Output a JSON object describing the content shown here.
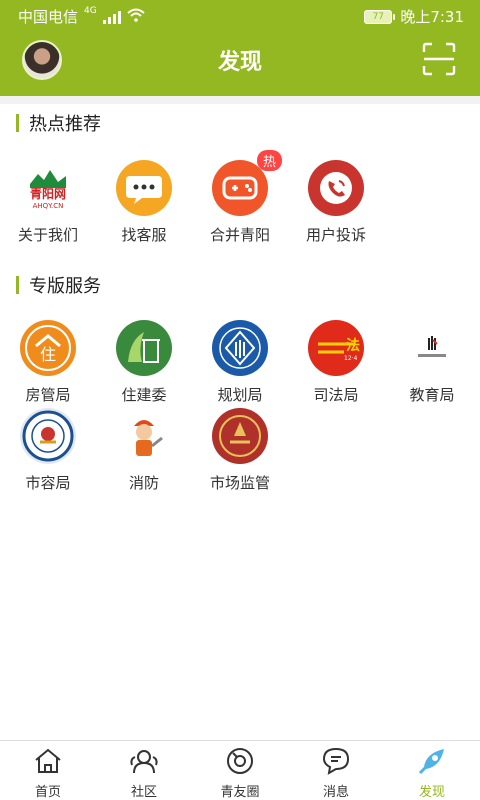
{
  "status": {
    "carrier": "中国电信",
    "network": "4G",
    "battery": "77",
    "time": "晚上7:31"
  },
  "header": {
    "title": "发现"
  },
  "sections": [
    {
      "title": "热点推荐",
      "items": [
        {
          "label": "关于我们",
          "icon": "qingyang-logo-icon"
        },
        {
          "label": "找客服",
          "icon": "chat-bubble-icon"
        },
        {
          "label": "合并青阳",
          "icon": "gamepad-icon",
          "badge": "热"
        },
        {
          "label": "用户投诉",
          "icon": "phone-icon"
        }
      ]
    },
    {
      "title": "专版服务",
      "items": [
        {
          "label": "房管局",
          "icon": "house-bureau-icon"
        },
        {
          "label": "住建委",
          "icon": "construction-committee-icon"
        },
        {
          "label": "规划局",
          "icon": "planning-bureau-icon"
        },
        {
          "label": "司法局",
          "icon": "justice-bureau-icon"
        },
        {
          "label": "教育局",
          "icon": "education-bureau-icon"
        },
        {
          "label": "市容局",
          "icon": "city-appearance-icon"
        },
        {
          "label": "消防",
          "icon": "firefighter-icon"
        },
        {
          "label": "市场监管",
          "icon": "market-supervision-icon"
        }
      ]
    }
  ],
  "tabs": [
    {
      "label": "首页",
      "icon": "home-icon"
    },
    {
      "label": "社区",
      "icon": "community-icon"
    },
    {
      "label": "青友圈",
      "icon": "camera-icon"
    },
    {
      "label": "消息",
      "icon": "message-icon"
    },
    {
      "label": "发现",
      "icon": "rocket-icon",
      "active": true
    }
  ],
  "colors": {
    "accent": "#94b821",
    "badge": "#ff4444"
  }
}
